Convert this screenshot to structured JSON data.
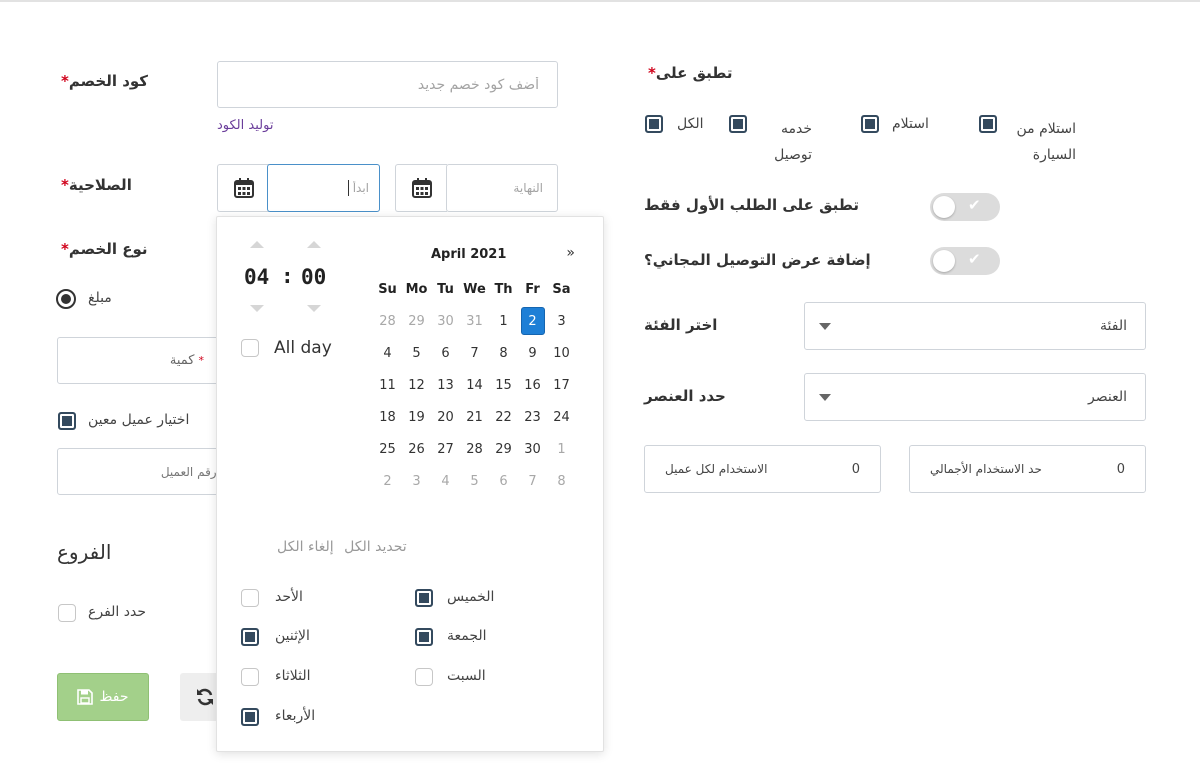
{
  "form": {
    "discount_code": {
      "label": "كود الخصم",
      "placeholder": "أضف كود خصم جديد",
      "generate_link": "توليد الكود"
    },
    "validity": {
      "label": "الصلاحية",
      "start_placeholder": "ابدأ",
      "end_placeholder": "النهاية"
    },
    "discount_type": {
      "label": "نوع الخصم",
      "option_amount": "مبلغ",
      "quantity_placeholder": "كمية",
      "specific_customer": "اختيار عميل معين",
      "customer_search_placeholder": "ابدء بكتابة اسم أو رقم العميل"
    },
    "branches": {
      "heading": "الفروع",
      "select_branch": "حدد الفرع"
    },
    "save_label": "حفظ"
  },
  "right": {
    "applies_to": {
      "label": "تطبق على",
      "options": [
        "استلام من السيارة",
        "استلام",
        "خدمه توصيل",
        "الكل"
      ]
    },
    "first_order_only": "تطبق على الطلب الأول فقط",
    "free_delivery": "إضافة عرض التوصيل المجاني؟",
    "category": {
      "label": "اختر الفئة",
      "value": "الفئة"
    },
    "item": {
      "label": "حدد العنصر",
      "value": "العنصر"
    },
    "per_customer": {
      "label": "الاستخدام لكل عميل",
      "value": "0"
    },
    "total_usage": {
      "label": "حد الاستخدام الأجمالي",
      "value": "0"
    }
  },
  "picker": {
    "hour": "04",
    "minute": "00",
    "separator": ":",
    "all_day": "All day",
    "month_title": "April 2021",
    "next": "»",
    "weekdays": [
      "Su",
      "Mo",
      "Tu",
      "We",
      "Th",
      "Fr",
      "Sa"
    ],
    "weeks": [
      [
        "28",
        "29",
        "30",
        "31",
        "1",
        "2",
        "3"
      ],
      [
        "4",
        "5",
        "6",
        "7",
        "8",
        "9",
        "10"
      ],
      [
        "11",
        "12",
        "13",
        "14",
        "15",
        "16",
        "17"
      ],
      [
        "18",
        "19",
        "20",
        "21",
        "22",
        "23",
        "24"
      ],
      [
        "25",
        "26",
        "27",
        "28",
        "29",
        "30",
        "1"
      ],
      [
        "2",
        "3",
        "4",
        "5",
        "6",
        "7",
        "8"
      ]
    ],
    "selected_day": "2",
    "select_all": "تحديد الكل",
    "deselect_all": "إلغاء الكل",
    "days": {
      "thursday": "الخميس",
      "sunday": "الأحد",
      "friday": "الجمعة",
      "monday": "الإثنين",
      "saturday": "السبت",
      "tuesday": "الثلاثاء",
      "wednesday": "الأربعاء"
    }
  },
  "colors": {
    "accent": "#1e7fd6",
    "checked": "#344a5e",
    "required": "#d0021b",
    "save": "#a3d08a",
    "link": "#6a3d9a"
  }
}
